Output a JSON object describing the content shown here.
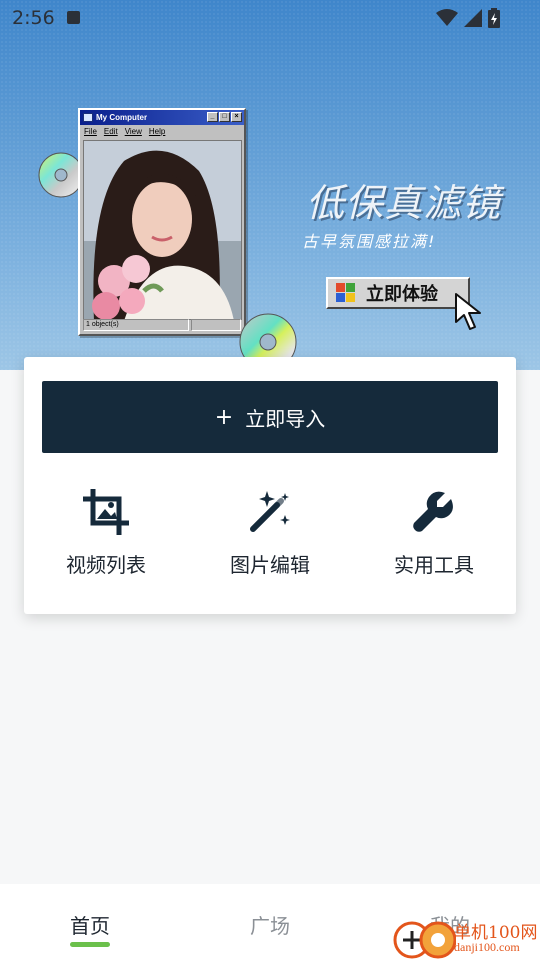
{
  "status_bar": {
    "time": "2:56"
  },
  "banner": {
    "window": {
      "title": "My Computer",
      "menu": [
        "File",
        "Edit",
        "View",
        "Help"
      ],
      "status": "1 object(s)"
    },
    "title": "低保真滤镜",
    "subtitle": "古早氛围感拉满!",
    "cta": "立即体验"
  },
  "card": {
    "import_plus": "+",
    "import_label": "立即导入",
    "tools": [
      {
        "label": "视频列表",
        "icon": "crop-image-icon"
      },
      {
        "label": "图片编辑",
        "icon": "magic-wand-icon"
      },
      {
        "label": "实用工具",
        "icon": "wrench-icon"
      }
    ]
  },
  "bottom_nav": {
    "items": [
      {
        "label": "首页",
        "active": true
      },
      {
        "label": "广场",
        "active": false
      },
      {
        "label": "我的",
        "active": false
      }
    ]
  },
  "watermark": {
    "name": "单机100网",
    "domain": "danji100.com"
  },
  "colors": {
    "primary": "#152a3b",
    "accent": "#6bc04b",
    "banner": "#5d9bd4"
  }
}
